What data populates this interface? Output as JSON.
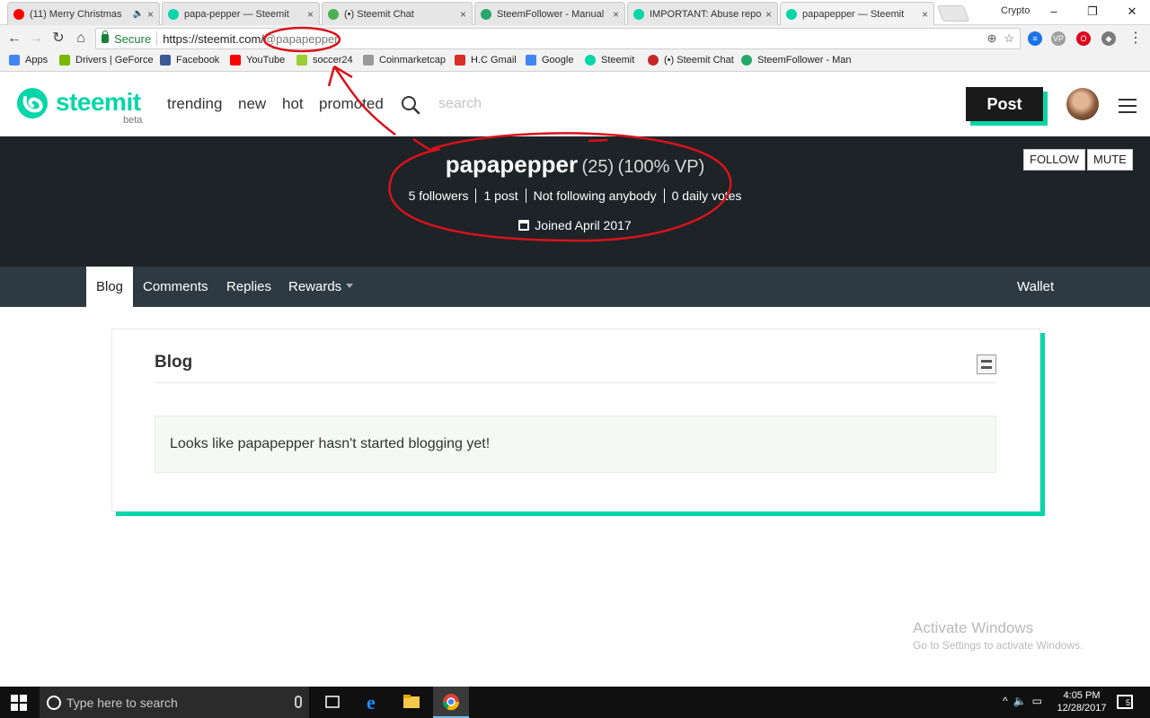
{
  "browser": {
    "tabs": [
      {
        "title": "(11) Merry Christmas",
        "favicon_color": "#ff0000",
        "audio": true
      },
      {
        "title": "papa-pepper — Steemit",
        "favicon_color": "#06d6a9"
      },
      {
        "title": "(•) Steemit Chat",
        "favicon_color": "#4caf50"
      },
      {
        "title": "SteemFollower - Manual",
        "favicon_color": "#27a86a"
      },
      {
        "title": "IMPORTANT: Abuse repo",
        "favicon_color": "#06d6a9"
      },
      {
        "title": "papapepper — Steemit",
        "favicon_color": "#06d6a9",
        "active": true
      }
    ],
    "profile_label": "Crypto",
    "secure_label": "Secure",
    "url_host": "https://steemit.com/",
    "url_path": "@papapepper",
    "bookmarks": [
      {
        "label": "Apps",
        "color": "#4285f4"
      },
      {
        "label": "Drivers | GeForce",
        "color": "#76b900"
      },
      {
        "label": "Facebook",
        "color": "#3b5998"
      },
      {
        "label": "YouTube",
        "color": "#ff0000"
      },
      {
        "label": "soccer24",
        "color": "#9acd32"
      },
      {
        "label": "Coinmarketcap",
        "color": "#999999"
      },
      {
        "label": "H.C Gmail",
        "color": "#d93025"
      },
      {
        "label": "Google",
        "color": "#4285f4"
      },
      {
        "label": "Steemit",
        "color": "#06d6a9"
      },
      {
        "label": "(•) Steemit Chat",
        "color": "#c62828"
      },
      {
        "label": "SteemFollower - Man",
        "color": "#27a86a"
      }
    ]
  },
  "site": {
    "logo_text": "steemit",
    "logo_beta": "beta",
    "nav": [
      "trending",
      "new",
      "hot",
      "promoted"
    ],
    "search_placeholder": "search",
    "post_label": "Post",
    "brand_color": "#06d6a9"
  },
  "profile": {
    "name": "papapepper",
    "reputation": "(25)",
    "voting_power": "(100% VP)",
    "stats": [
      "5 followers",
      "1 post",
      "Not following anybody",
      "0 daily votes"
    ],
    "joined": "Joined April 2017",
    "follow_label": "FOLLOW",
    "mute_label": "MUTE",
    "tabs": [
      "Blog",
      "Comments",
      "Replies",
      "Rewards"
    ],
    "wallet_label": "Wallet"
  },
  "blog": {
    "heading": "Blog",
    "empty_message": "Looks like papapepper hasn't started blogging yet!"
  },
  "watermark": {
    "title": "Activate Windows",
    "subtitle": "Go to Settings to activate Windows."
  },
  "taskbar": {
    "search_placeholder": "Type here to search",
    "time": "4:05 PM",
    "date": "12/28/2017",
    "notifications": "5"
  }
}
